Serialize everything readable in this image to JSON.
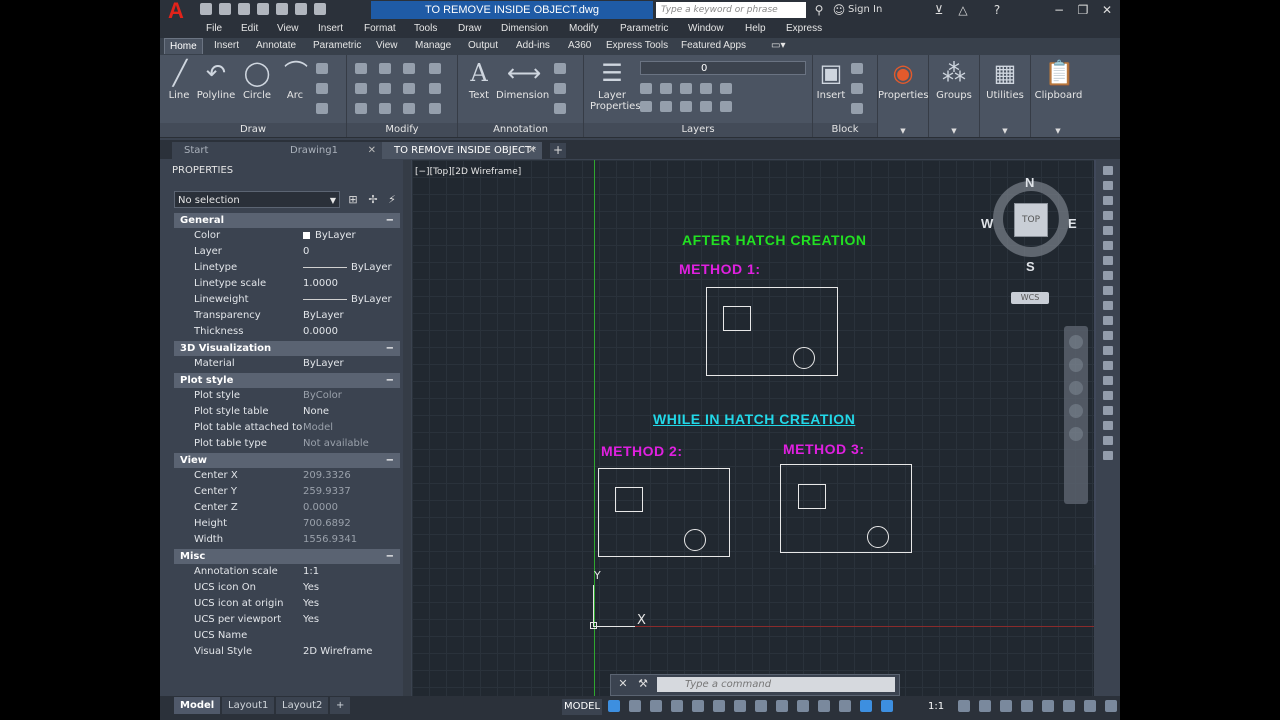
{
  "app": {
    "logo": "A",
    "document_title": "TO REMOVE INSIDE OBJECT.dwg",
    "search_placeholder": "Type a keyword or phrase",
    "sign_in": "Sign In"
  },
  "menu": [
    "File",
    "Edit",
    "View",
    "Insert",
    "Format",
    "Tools",
    "Draw",
    "Dimension",
    "Modify",
    "Parametric",
    "Window",
    "Help",
    "Express"
  ],
  "ribbon_tabs": [
    "Home",
    "Insert",
    "Annotate",
    "Parametric",
    "View",
    "Manage",
    "Output",
    "Add-ins",
    "A360",
    "Express Tools",
    "Featured Apps"
  ],
  "ribbon": {
    "draw": {
      "title": "Draw",
      "tools": [
        "Line",
        "Polyline",
        "Circle",
        "Arc"
      ]
    },
    "modify": {
      "title": "Modify"
    },
    "annotation": {
      "title": "Annotation",
      "tools": [
        "Text",
        "Dimension"
      ]
    },
    "layers": {
      "title": "Layers",
      "tool": "Layer Properties",
      "current_layer": "0"
    },
    "block": {
      "title": "Block",
      "tool": "Insert"
    },
    "properties": {
      "tool": "Properties"
    },
    "groups": {
      "tool": "Groups"
    },
    "utilities": {
      "tool": "Utilities"
    },
    "clipboard": {
      "tool": "Clipboard"
    }
  },
  "file_tabs": [
    {
      "label": "Start"
    },
    {
      "label": "Drawing1"
    },
    {
      "label": "TO REMOVE INSIDE OBJECT*"
    }
  ],
  "properties": {
    "title": "PROPERTIES",
    "selection": "No selection",
    "sections": [
      {
        "name": "General",
        "rows": [
          {
            "k": "Color",
            "v": "ByLayer"
          },
          {
            "k": "Layer",
            "v": "0"
          },
          {
            "k": "Linetype",
            "v": "ByLayer"
          },
          {
            "k": "Linetype scale",
            "v": "1.0000"
          },
          {
            "k": "Lineweight",
            "v": "ByLayer"
          },
          {
            "k": "Transparency",
            "v": "ByLayer"
          },
          {
            "k": "Thickness",
            "v": "0.0000"
          }
        ]
      },
      {
        "name": "3D Visualization",
        "rows": [
          {
            "k": "Material",
            "v": "ByLayer"
          }
        ]
      },
      {
        "name": "Plot style",
        "rows": [
          {
            "k": "Plot style",
            "v": "ByColor"
          },
          {
            "k": "Plot style table",
            "v": "None"
          },
          {
            "k": "Plot table attached to",
            "v": "Model"
          },
          {
            "k": "Plot table type",
            "v": "Not available"
          }
        ]
      },
      {
        "name": "View",
        "rows": [
          {
            "k": "Center X",
            "v": "209.3326"
          },
          {
            "k": "Center Y",
            "v": "259.9337"
          },
          {
            "k": "Center Z",
            "v": "0.0000"
          },
          {
            "k": "Height",
            "v": "700.6892"
          },
          {
            "k": "Width",
            "v": "1556.9341"
          }
        ]
      },
      {
        "name": "Misc",
        "rows": [
          {
            "k": "Annotation scale",
            "v": "1:1"
          },
          {
            "k": "UCS icon On",
            "v": "Yes"
          },
          {
            "k": "UCS icon at origin",
            "v": "Yes"
          },
          {
            "k": "UCS per viewport",
            "v": "Yes"
          },
          {
            "k": "UCS Name",
            "v": ""
          },
          {
            "k": "Visual Style",
            "v": "2D Wireframe"
          }
        ]
      }
    ]
  },
  "viewport": {
    "label": "[−][Top][2D Wireframe]",
    "texts": {
      "after": "AFTER HATCH CREATION",
      "method1": "METHOD 1:",
      "while": "WHILE IN HATCH CREATION",
      "method2": "METHOD 2:",
      "method3": "METHOD 3:"
    },
    "colors": {
      "green": "#22e022",
      "magenta": "#e020e0",
      "cyan": "#22d8e8"
    },
    "compass": {
      "n": "N",
      "s": "S",
      "e": "E",
      "w": "W",
      "top": "TOP",
      "wcs": "WCS"
    },
    "ucs": {
      "y": "Y",
      "x": "X"
    }
  },
  "command": {
    "placeholder": "Type a command"
  },
  "layout_tabs": [
    "Model",
    "Layout1",
    "Layout2"
  ],
  "status": {
    "model": "MODEL",
    "scale": "1:1"
  }
}
